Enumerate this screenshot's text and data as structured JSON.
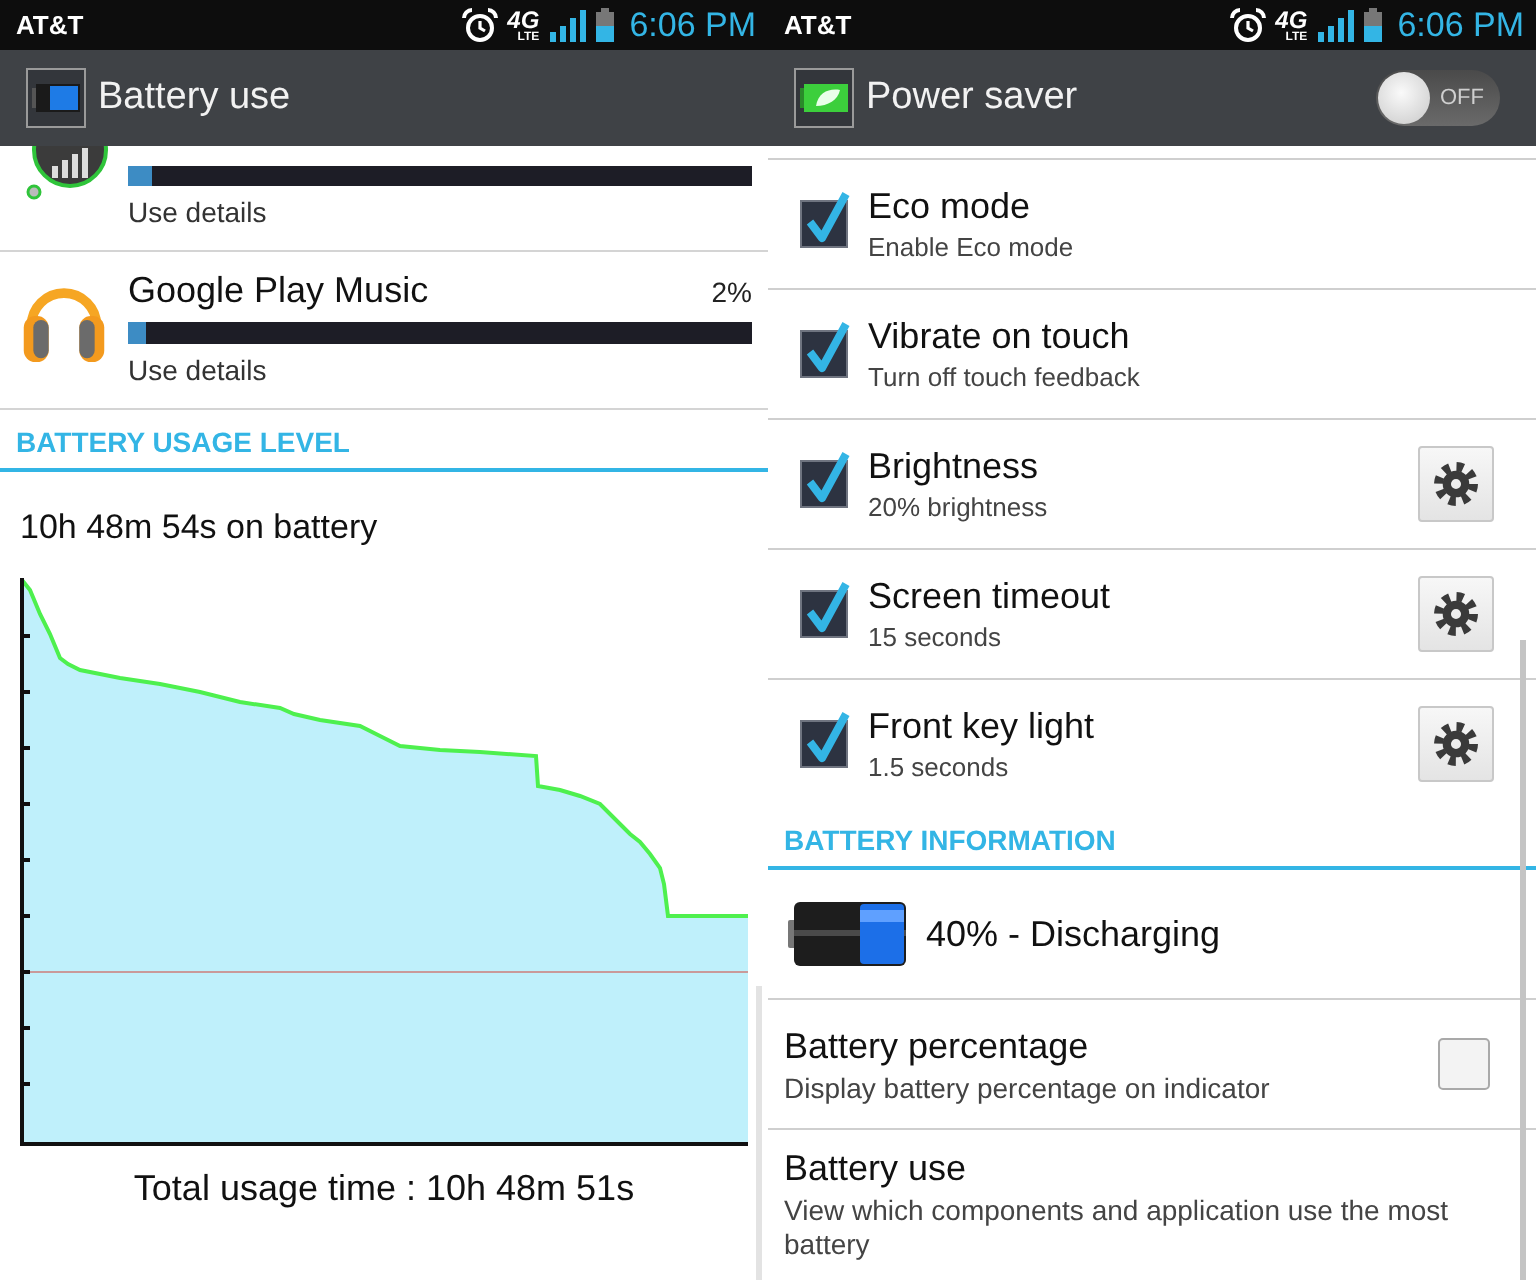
{
  "battery_use_screen": {
    "status_bar": {
      "carrier": "AT&T",
      "network": "4G",
      "network_sub": "LTE",
      "time": "6:06 PM"
    },
    "action_bar": {
      "title": "Battery use"
    },
    "apps": [
      {
        "level": 0.04,
        "details": "Use details"
      },
      {
        "name": "Google Play Music",
        "percent": "2%",
        "level": 0.03,
        "details": "Use details"
      }
    ],
    "section_header": "BATTERY USAGE LEVEL",
    "on_battery": "10h 48m 54s on battery",
    "total_usage": "Total usage time : 10h 48m 51s"
  },
  "power_saver_screen": {
    "status_bar": {
      "carrier": "AT&T",
      "network": "4G",
      "network_sub": "LTE",
      "time": "6:06 PM"
    },
    "action_bar": {
      "title": "Power saver",
      "switch": {
        "label": "OFF",
        "on": false
      }
    },
    "settings": [
      {
        "kind": "check",
        "title": "Eco mode",
        "summary": "Enable Eco mode",
        "checked": true
      },
      {
        "kind": "check",
        "title": "Vibrate on touch",
        "summary": "Turn off touch feedback",
        "checked": true
      },
      {
        "kind": "check_gear",
        "title": "Brightness",
        "summary": "20% brightness",
        "checked": true
      },
      {
        "kind": "check_gear",
        "title": "Screen timeout",
        "summary": "15 seconds",
        "checked": true
      },
      {
        "kind": "check_gear",
        "title": "Front key light",
        "summary": "1.5 seconds",
        "checked": true
      }
    ],
    "section_header": "BATTERY INFORMATION",
    "battery_status": "40% - Discharging",
    "items": [
      {
        "kind": "checkbox",
        "title": "Battery percentage",
        "summary": "Display battery percentage on indicator",
        "checked": false
      },
      {
        "kind": "link",
        "title": "Battery use",
        "summary": "View which components and application use the most battery"
      }
    ]
  }
}
